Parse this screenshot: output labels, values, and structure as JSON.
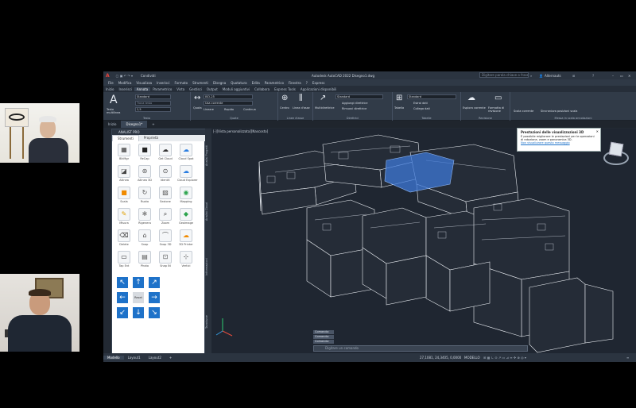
{
  "app": {
    "title": "Autodesk AutoCAD 2022  Disegno1.dwg",
    "quick_label": "Condividi",
    "search_placeholder": "Digitare parola chiave o frase",
    "user": "Alternauts",
    "menu": [
      "File",
      "Modifica",
      "Visualizza",
      "Inserisci",
      "Formato",
      "Strumenti",
      "Disegna",
      "Quotatura",
      "Edita",
      "Parametrico",
      "Finestra",
      "?",
      "Express"
    ],
    "ribbon_tabs": [
      {
        "label": "Inizio"
      },
      {
        "label": "Inserisci"
      },
      {
        "label": "Annota",
        "active": true
      },
      {
        "label": "Parametrico"
      },
      {
        "label": "Vista"
      },
      {
        "label": "Gestisci"
      },
      {
        "label": "Output"
      },
      {
        "label": "Moduli aggiuntivi"
      },
      {
        "label": "Collabora"
      },
      {
        "label": "Express Tools"
      },
      {
        "label": "Applicazioni disponibili"
      }
    ],
    "ribbon": {
      "testo": {
        "big": "A",
        "big_label": "Testo multilinea",
        "style": "Standard",
        "find_placeholder": "Trova testo",
        "height": "2,5",
        "group": "Testo"
      },
      "quote": {
        "big_label": "Quota",
        "style": "ISO-25",
        "use_current": "Usa corrente",
        "lineare": "Lineare",
        "rapido": "Rapido",
        "continua": "Continua",
        "group": "Quote"
      },
      "linee_asse": {
        "centro": "Centro",
        "linea_asse": "Linea d'asse",
        "group": "Linee d'asse"
      },
      "direttrici": {
        "multi": "Multidirettrice",
        "style": "Standard",
        "aggiungi": "Aggiungi direttrice",
        "rimuovi": "Rimuovi direttrice",
        "group": "Direttrici"
      },
      "tabelle": {
        "big_label": "Tabella",
        "style": "Standard",
        "estrai": "Estrai dati",
        "collega": "Collega dati",
        "group": "Tabelle"
      },
      "revisione": {
        "esplora": "Esplora corrente",
        "formatta": "Formatta di revisione",
        "group": "Revisione"
      },
      "scala": {
        "corrente": "Scala corrente",
        "sincronizza": "Sincronizza posizioni scala",
        "group": "Messa in scala annotazioni"
      }
    },
    "doc_tabs": [
      {
        "label": "Inizio"
      },
      {
        "label": "Disegno1*",
        "active": true
      },
      {
        "label": "+"
      }
    ],
    "viewport_label": "[-][Vista personalizzata][Nascosto]",
    "popup": {
      "title": "Prestazioni delle visualizzazioni 3D",
      "body": "È possibile migliorare le prestazioni per le operazioni di rotazione, zoom e panoramica 3D.",
      "link": "Non visualizzare questo messaggio"
    },
    "command_history": [
      "Comando:",
      "Comando:",
      "Comando:"
    ],
    "command_placeholder": "Digitare un comando",
    "coords": "27,1081, 24,3405, 0,0000",
    "mode": "MODELLO",
    "layout_tabs": [
      {
        "label": "Modello",
        "active": true
      },
      {
        "label": "Layout1"
      },
      {
        "label": "Layout2"
      },
      {
        "label": "+"
      }
    ]
  },
  "palette": {
    "title": "ANALIST PRO",
    "tabs": [
      {
        "label": "Strumenti",
        "active": true
      },
      {
        "label": "Proprietà"
      }
    ],
    "tools": [
      {
        "label": "BlkMgr",
        "icon": "block-manager-icon",
        "glyph": "▦",
        "color": "#333"
      },
      {
        "label": "ReCap",
        "icon": "recap-icon",
        "glyph": "■",
        "color": "#222"
      },
      {
        "label": "Get Cloud",
        "icon": "get-cloud-icon",
        "glyph": "☁",
        "color": "#333"
      },
      {
        "label": "Cloud Spot",
        "icon": "cloud-spot-icon",
        "glyph": "☁",
        "color": "#2a7de1"
      },
      {
        "label": "Allinea",
        "icon": "align-icon",
        "glyph": "◪",
        "color": "#444"
      },
      {
        "label": "Allinea 3D",
        "icon": "align-3d-icon",
        "glyph": "⊛",
        "color": "#555"
      },
      {
        "label": "Identif.",
        "icon": "identify-icon",
        "glyph": "⊙",
        "color": "#444"
      },
      {
        "label": "Cloud Explorer",
        "icon": "cloud-explorer-icon",
        "glyph": "☁",
        "color": "#2a7de1"
      },
      {
        "label": "Scala",
        "icon": "scale-icon",
        "glyph": "■",
        "color": "#f08a00"
      },
      {
        "label": "Ruota",
        "icon": "rotate-icon",
        "glyph": "↻",
        "color": "#555"
      },
      {
        "label": "Sezione",
        "icon": "section-icon",
        "glyph": "▨",
        "color": "#555"
      },
      {
        "label": "Mapping",
        "icon": "mapping-icon",
        "glyph": "◉",
        "color": "#2da44e"
      },
      {
        "label": "Misura",
        "icon": "measure-icon",
        "glyph": "✎",
        "color": "#e0a000"
      },
      {
        "label": "Rigenera",
        "icon": "regenerate-icon",
        "glyph": "✱",
        "color": "#888"
      },
      {
        "label": "Zoom",
        "icon": "zoom-icon",
        "glyph": "⌕",
        "color": "#333"
      },
      {
        "label": "Geoimage",
        "icon": "geoimage-icon",
        "glyph": "◆",
        "color": "#2da44e"
      },
      {
        "label": "Delete",
        "icon": "delete-icon",
        "glyph": "⌫",
        "color": "#333"
      },
      {
        "label": "Snap",
        "icon": "snap-icon",
        "glyph": "⌂",
        "color": "#555"
      },
      {
        "label": "Snap 3D",
        "icon": "snap-3d-icon",
        "glyph": "⌒",
        "color": "#555"
      },
      {
        "label": "3D Printer",
        "icon": "printer-3d-icon",
        "glyph": "☁",
        "color": "#f08a00"
      },
      {
        "label": "Tap Ent",
        "icon": "tap-entity-icon",
        "glyph": "▭",
        "color": "#333"
      },
      {
        "label": "Photo",
        "icon": "photo-icon",
        "glyph": "▤",
        "color": "#555"
      },
      {
        "label": "Snap IN",
        "icon": "snap-in-icon",
        "glyph": "⊡",
        "color": "#555"
      },
      {
        "label": "Vertici",
        "icon": "vertices-icon",
        "glyph": "⊹",
        "color": "#555"
      }
    ],
    "arrows": [
      {
        "glyph": "↖",
        "icon": "arrow-up-left-icon"
      },
      {
        "glyph": "↑",
        "icon": "arrow-up-icon"
      },
      {
        "glyph": "↗",
        "icon": "arrow-up-right-icon"
      },
      {
        "glyph": "←",
        "icon": "arrow-left-icon"
      },
      {
        "glyph": "",
        "icon": "center-button",
        "label": "Reset"
      },
      {
        "glyph": "→",
        "icon": "arrow-right-icon"
      },
      {
        "glyph": "↙",
        "icon": "arrow-down-left-icon"
      },
      {
        "glyph": "↓",
        "icon": "arrow-down-icon"
      },
      {
        "glyph": "↘",
        "icon": "arrow-down-right-icon"
      }
    ],
    "side_tabs": [
      "Analisi Progetti",
      "Analist Cloud",
      "Informazioni",
      "Tavolozze"
    ]
  },
  "colors": {
    "accent": "#1e72c9",
    "selection": "#3d78d8",
    "app_bg": "#222933"
  }
}
